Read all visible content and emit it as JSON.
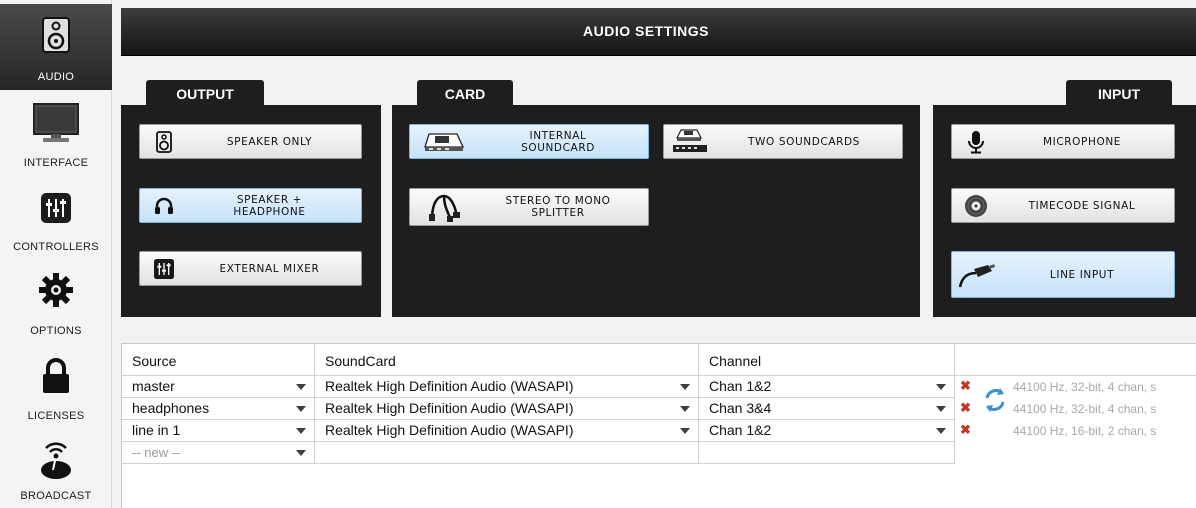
{
  "sidebar": {
    "items": [
      {
        "label": "AUDIO",
        "icon": "speaker-icon",
        "active": true
      },
      {
        "label": "INTERFACE",
        "icon": "monitor-icon"
      },
      {
        "label": "CONTROLLERS",
        "icon": "mixer-sliders-icon"
      },
      {
        "label": "OPTIONS",
        "icon": "gear-icon"
      },
      {
        "label": "LICENSES",
        "icon": "lock-icon"
      },
      {
        "label": "BROADCAST",
        "icon": "broadcast-antenna-icon"
      }
    ]
  },
  "header": {
    "title": "AUDIO SETTINGS"
  },
  "output": {
    "tab": "OUTPUT",
    "buttons": [
      {
        "label": "SPEAKER ONLY",
        "icon": "speaker-icon"
      },
      {
        "label1": "SPEAKER +",
        "label2": "HEADPHONE",
        "icon": "headphone-icon",
        "selected": true
      },
      {
        "label": "EXTERNAL MIXER",
        "icon": "mixer-sliders-icon"
      }
    ]
  },
  "card": {
    "tab": "CARD",
    "buttons": [
      {
        "label1": "INTERNAL",
        "label2": "SOUNDCARD",
        "icon": "soundcard-icon",
        "selected": true
      },
      {
        "label": "TWO SOUNDCARDS",
        "icon": "two-soundcards-icon"
      },
      {
        "label1": "STEREO TO MONO",
        "label2": "SPLITTER",
        "icon": "splitter-cable-icon"
      }
    ]
  },
  "input": {
    "tab": "INPUT",
    "buttons": [
      {
        "label": "MICROPHONE",
        "icon": "microphone-icon"
      },
      {
        "label": "TIMECODE SIGNAL",
        "icon": "vinyl-icon"
      },
      {
        "label": "LINE INPUT",
        "icon": "line-cable-icon",
        "selected": true
      }
    ]
  },
  "table": {
    "headers": [
      "Source",
      "SoundCard",
      "Channel"
    ],
    "rows": [
      {
        "source": "master",
        "soundcard": "Realtek High Definition Audio (WASAPI)",
        "channel": "Chan 1&2",
        "info": "44100 Hz, 32-bit, 4 chan, s"
      },
      {
        "source": "headphones",
        "soundcard": "Realtek High Definition Audio (WASAPI)",
        "channel": "Chan 3&4",
        "info": "44100 Hz, 32-bit, 4 chan, s"
      },
      {
        "source": "line in 1",
        "soundcard": "Realtek High Definition Audio (WASAPI)",
        "channel": "Chan 1&2",
        "info": "44100 Hz, 16-bit, 2 chan, s"
      }
    ],
    "new_row": "-- new --"
  },
  "colors": {
    "selected": "#c7e2fa",
    "panel": "#1e1e1e",
    "delete": "#c0392b"
  }
}
